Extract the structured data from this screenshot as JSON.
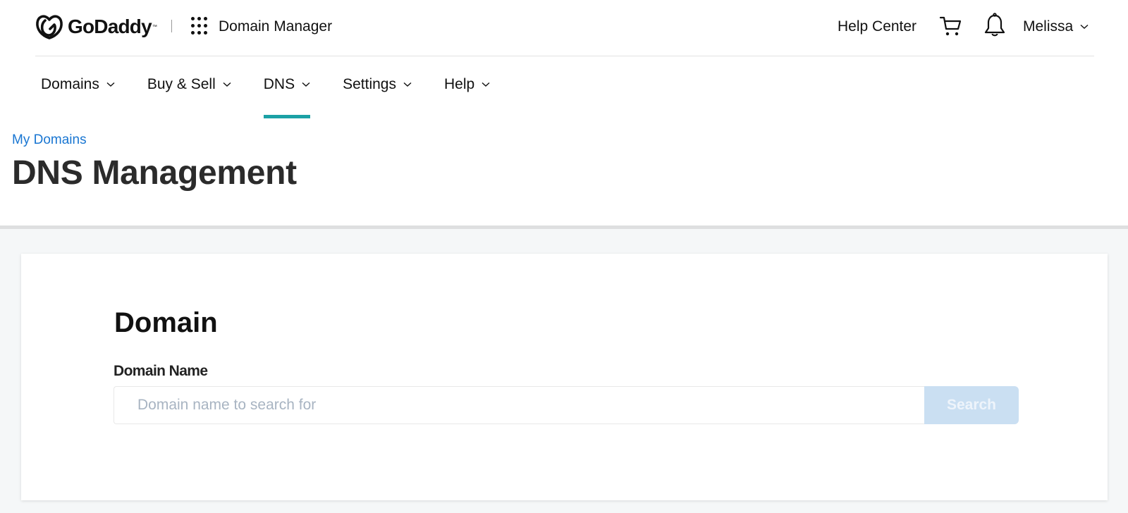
{
  "header": {
    "logo_text": "GoDaddy",
    "logo_tm": "™",
    "product_name": "Domain Manager",
    "help_center": "Help Center",
    "user_name": "Melissa",
    "icons": {
      "logo": "godaddy-logo-icon",
      "apps": "apps-grid-icon",
      "cart": "cart-icon",
      "notifications": "bell-icon",
      "user_dropdown": "chevron-down-icon"
    }
  },
  "nav": {
    "items": [
      {
        "label": "Domains",
        "active": false
      },
      {
        "label": "Buy & Sell",
        "active": false
      },
      {
        "label": "DNS",
        "active": true
      },
      {
        "label": "Settings",
        "active": false
      },
      {
        "label": "Help",
        "active": false
      }
    ],
    "active_indicator_color": "#1ba1a5"
  },
  "breadcrumb": {
    "link": "My Domains",
    "link_color": "#1976d2"
  },
  "page": {
    "title": "DNS Management"
  },
  "card": {
    "title": "Domain",
    "field_label": "Domain Name",
    "input_value": "",
    "input_placeholder": "Domain name to search for",
    "search_button": "Search",
    "search_button_disabled": true,
    "search_button_color": "#cadff2"
  }
}
